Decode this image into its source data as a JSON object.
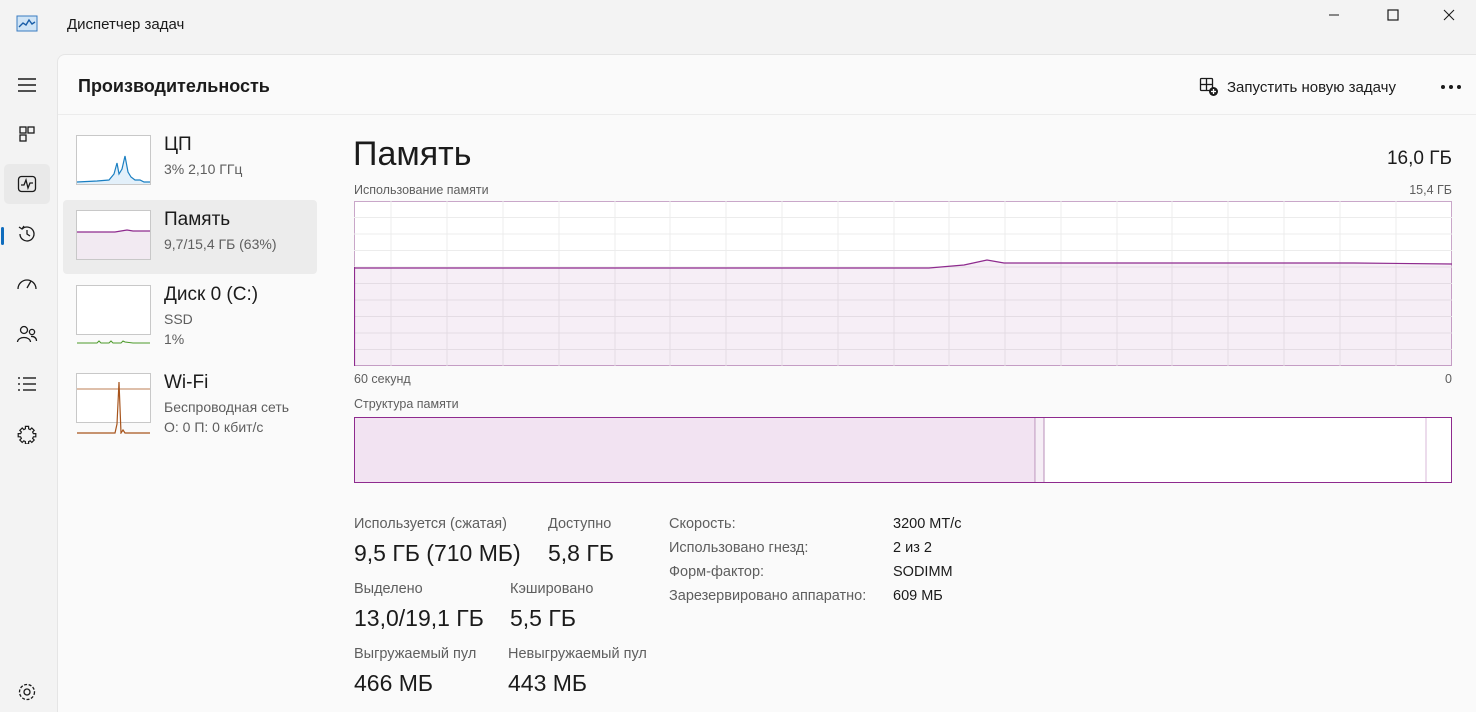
{
  "window": {
    "title": "Диспетчер задач"
  },
  "header": {
    "title": "Производительность",
    "run_task_label": "Запустить новую задачу"
  },
  "nav": [
    "menu-icon",
    "processes-icon",
    "performance-icon",
    "app-history-icon",
    "startup-apps-icon",
    "users-icon",
    "details-icon",
    "services-icon",
    "settings-icon"
  ],
  "resources": [
    {
      "name": "ЦП",
      "line1": "3% 2,10 ГГц",
      "line2": ""
    },
    {
      "name": "Память",
      "line1": "9,7/15,4 ГБ (63%)",
      "line2": ""
    },
    {
      "name": "Диск 0 (C:)",
      "line1": "SSD",
      "line2": "1%"
    },
    {
      "name": "Wi-Fi",
      "line1": "Беспроводная сеть",
      "line2": "О: 0 П: 0 кбит/с"
    }
  ],
  "detail": {
    "title": "Память",
    "total": "16,0 ГБ",
    "usage_label": "Использование памяти",
    "usage_max": "15,4 ГБ",
    "time_left": "60 секунд",
    "time_right": "0",
    "structure_label": "Структура памяти",
    "stats": [
      {
        "label": "Используется (сжатая)",
        "value": "9,5 ГБ (710 МБ)"
      },
      {
        "label": "Доступно",
        "value": "5,8 ГБ"
      },
      {
        "label": "Выделено",
        "value": "13,0/19,1 ГБ"
      },
      {
        "label": "Кэшировано",
        "value": "5,5 ГБ"
      },
      {
        "label": "Выгружаемый пул",
        "value": "466 МБ"
      },
      {
        "label": "Невыгружаемый пул",
        "value": "443 МБ"
      }
    ],
    "specs": [
      {
        "key": "Скорость:",
        "value": "3200 МТ/с"
      },
      {
        "key": "Использовано гнезд:",
        "value": "2 из 2"
      },
      {
        "key": "Форм-фактор:",
        "value": "SODIMM"
      },
      {
        "key": "Зарезервировано аппаратно:",
        "value": "609 МБ"
      }
    ]
  },
  "colors": {
    "memory": "#8e2a8e",
    "memory_fill": "#f2eaf2",
    "cpu": "#1a7fc2",
    "disk": "#4c9a2a",
    "wifi": "#a7541c",
    "accent": "#0f6cbd"
  }
}
